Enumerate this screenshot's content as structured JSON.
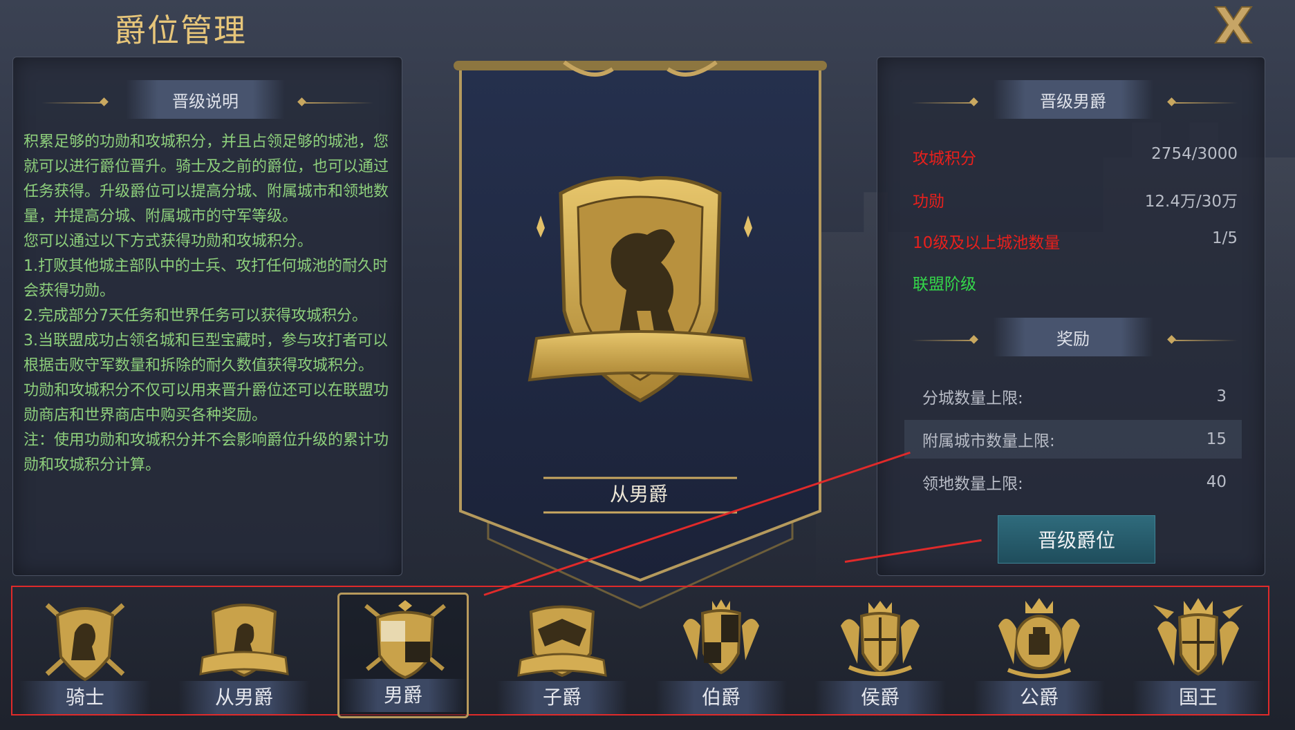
{
  "window": {
    "title": "爵位管理"
  },
  "left_panel": {
    "header": "晋级说明",
    "paragraphs": [
      "积累足够的功勋和攻城积分，并且占领足够的城池，您就可以进行爵位晋升。骑士及之前的爵位，也可以通过任务获得。升级爵位可以提高分城、附属城市和领地数量，并提高分城、附属城市的守军等级。",
      "您可以通过以下方式获得功勋和攻城积分。",
      "1.打败其他城主部队中的士兵、攻打任何城池的耐久时会获得功勋。",
      "2.完成部分7天任务和世界任务可以获得攻城积分。",
      "3.当联盟成功占领名城和巨型宝藏时，参与攻打者可以根据击败守军数量和拆除的耐久数值获得攻城积分。",
      "功勋和攻城积分不仅可以用来晋升爵位还可以在联盟功勋商店和世界商店中购买各种奖励。",
      "注：使用功勋和攻城积分并不会影响爵位升级的累计功勋和攻城积分计算。"
    ]
  },
  "center": {
    "current_rank": "从男爵"
  },
  "right_panel": {
    "header": "晋级男爵",
    "requirements": [
      {
        "label": "攻城积分",
        "value": "2754/3000",
        "color": "#e8201c"
      },
      {
        "label": "功勋",
        "value": "12.4万/30万",
        "color": "#e8201c"
      },
      {
        "label": "10级及以上城池数量",
        "value": "1/5",
        "color": "#e8201c"
      },
      {
        "label": "联盟阶级",
        "value": "",
        "color": "#35d84a"
      }
    ],
    "rewards_header": "奖励",
    "rewards": [
      {
        "label": "分城数量上限:",
        "value": "3"
      },
      {
        "label": "附属城市数量上限:",
        "value": "15"
      },
      {
        "label": "领地数量上限:",
        "value": "40"
      }
    ],
    "promote_button": "晋级爵位"
  },
  "ranks": [
    {
      "name": "骑士",
      "icon": "knight-crest-icon"
    },
    {
      "name": "从男爵",
      "icon": "baronet-crest-icon"
    },
    {
      "name": "男爵",
      "icon": "baron-crest-icon",
      "selected": true
    },
    {
      "name": "子爵",
      "icon": "viscount-crest-icon"
    },
    {
      "name": "伯爵",
      "icon": "earl-crest-icon"
    },
    {
      "name": "侯爵",
      "icon": "marquis-crest-icon"
    },
    {
      "name": "公爵",
      "icon": "duke-crest-icon"
    },
    {
      "name": "国王",
      "icon": "king-crest-icon"
    }
  ],
  "colors": {
    "gold": "#c9a860",
    "title": "#e7c67a",
    "description": "#8ed07c",
    "annotation": "#e02a2a",
    "button": "#2a6172"
  }
}
